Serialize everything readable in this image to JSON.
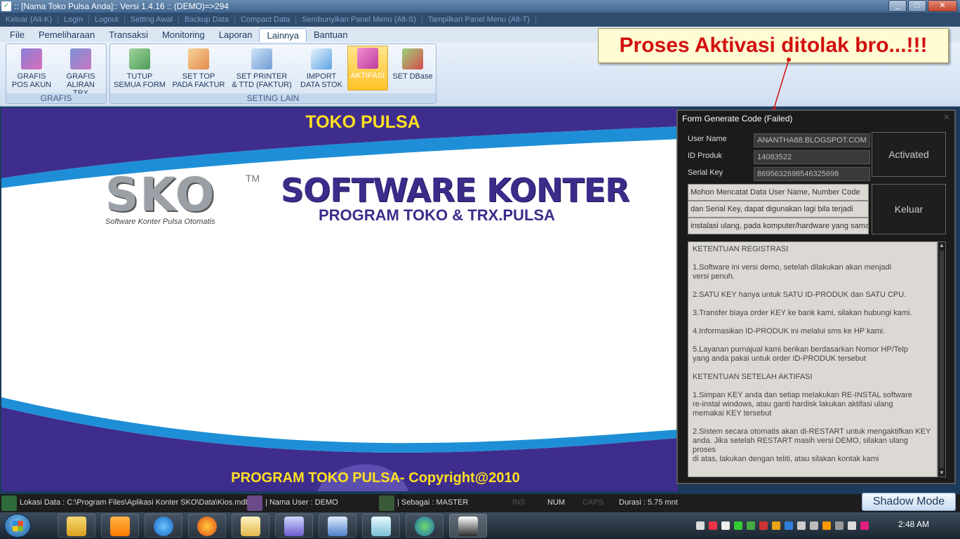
{
  "window": {
    "title": ":: [Nama Toko Pulsa Anda]:: Versi 1.4.16 :: (DEMO)=>294"
  },
  "quickbar": [
    "Keluar (Alt-K)",
    "Login",
    "Logout",
    "Setting Awal",
    "Backup Data",
    "Compact Data",
    "Sembunyikan Panel Menu (Alt-S)",
    "Tampilkan Panel Menu (Alt-T)"
  ],
  "menu": [
    "File",
    "Pemeliharaan",
    "Transaksi",
    "Monitoring",
    "Laporan",
    "Lainnya",
    "Bantuan"
  ],
  "menu_active": "Lainnya",
  "ribbon": {
    "grafis_group": "GRAFIS",
    "seting_group": "SETING LAIN",
    "buttons": [
      {
        "line1": "GRAFIS",
        "line2": "POS AKUN",
        "icon": "chart-icon"
      },
      {
        "line1": "GRAFIS",
        "line2": "ALIRAN TRX",
        "icon": "chart-line-icon"
      },
      {
        "line1": "TUTUP",
        "line2": "SEMUA FORM",
        "icon": "close-forms-icon"
      },
      {
        "line1": "SET TOP",
        "line2": "PADA FAKTUR",
        "icon": "invoice-icon"
      },
      {
        "line1": "SET PRINTER",
        "line2": "& TTD (FAKTUR)",
        "icon": "printer-icon"
      },
      {
        "line1": "IMPORT",
        "line2": "DATA STOK",
        "icon": "import-icon"
      },
      {
        "line1": "AKTIFASI",
        "line2": "",
        "icon": "puzzle-icon"
      },
      {
        "line1": "SET DBase",
        "line2": "",
        "icon": "database-icon"
      }
    ]
  },
  "callout": "Proses Aktivasi ditolak bro...!!!",
  "banner": {
    "top_title": "TOKO PULSA",
    "logo_text": "SKO",
    "logo_tm": "TM",
    "logo_sub": "Software Konter Pulsa Otomatis",
    "title": "SOFTWARE KONTER",
    "subtitle": "PROGRAM TOKO & TRX.PULSA",
    "bottom_title": "PROGRAM  TOKO PULSA- Copyright@2010"
  },
  "dialog": {
    "title": "Form Generate Code (Failed)",
    "fields": [
      {
        "label": "User Name",
        "value": "ANANTHA88.BLOGSPOT.COM"
      },
      {
        "label": "ID Produk",
        "value": "14083522"
      },
      {
        "label": "Serial Key",
        "value": "8695632698546325698"
      }
    ],
    "activated_button": "Activated",
    "keluar_button": "Keluar",
    "notes": [
      "Mohon Mencatat Data User Name, Number Code",
      "dan Serial Key, dapat digunakan lagi bila terjadi",
      "instalasi ulang, pada komputer/hardware yang sama"
    ],
    "terms": [
      "KETENTUAN REGISTRASI",
      "1.Software ini versi demo, setelah dilakukan akan menjadi\nversi penuh.",
      "2.SATU KEY hanya untuk SATU ID-PRODUK dan SATU CPU.",
      "3.Transfer biaya order KEY ke bank kami, silakan hubungi kami.",
      "4.Informasikan ID-PRODUK ini melalui sms ke HP kami.",
      "5.Layanan purnajual kami berikan berdasarkan Nomor HP/Telp\nyang anda pakai untuk order ID-PRODUK tersebut",
      "KETENTUAN SETELAH AKTIFASI",
      "1.Simpan KEY anda dan setiap melakukan RE-INSTAL software\nre-instal windows, atau ganti hardisk lakukan aktifasi ulang\nmemakai KEY tersebut",
      "2.Sistem secara otomatis akan di-RESTART untuk mengaktifkan KEY\nanda. Jika setelah RESTART masih versi DEMO, silakan ulang proses\ndi atas, lakukan dengan teliti, atau silakan kontak kami"
    ]
  },
  "status": {
    "lokasi": "Lokasi Data : C:\\Program Files\\Aplikasi Konter SKO\\Data\\Kios.mdb",
    "user": "| Nama User : DEMO",
    "role": "| Sebagai : MASTER",
    "ins": "INS",
    "num": "NUM",
    "caps": "CAPS",
    "durasi": "Durasi : 5.75 mnt",
    "shadow_mode": "Shadow Mode"
  },
  "taskbar": {
    "clock": "2:48 AM"
  },
  "colors": {
    "callout_text": "#d20f0f",
    "banner_purple": "#3c2c8a",
    "banner_yellow": "#ffe022"
  }
}
